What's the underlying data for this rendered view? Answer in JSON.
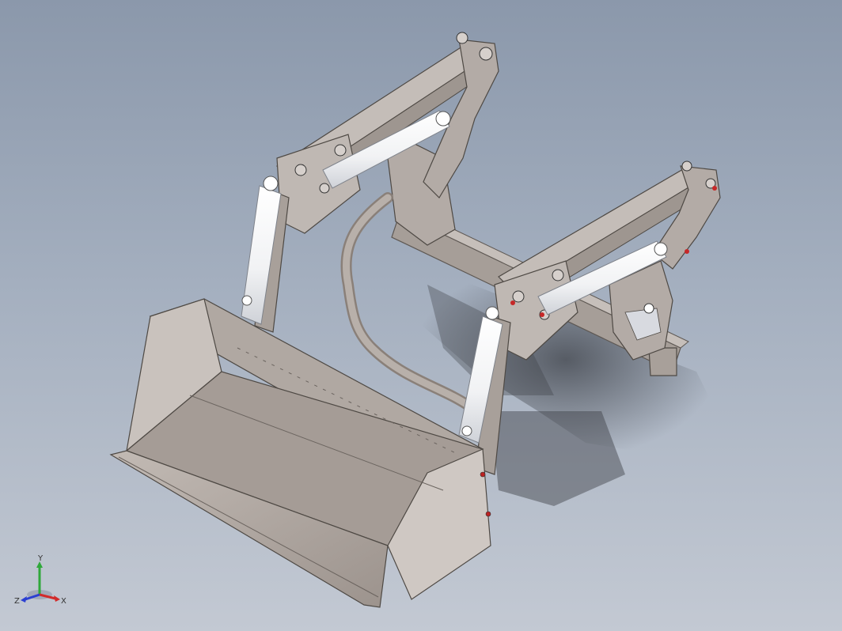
{
  "viewport": {
    "background_top": "#8b98ab",
    "background_bottom": "#c3c9d3"
  },
  "model": {
    "frame_color": "#b2aaa5",
    "frame_dark": "#6f6862",
    "cylinder_color": "#f4f5f7",
    "bucket_color": "#ada49e",
    "shadow_color": "#3b3e45"
  },
  "triad": {
    "x_label": "X",
    "y_label": "Y",
    "z_label": "Z",
    "x_color": "#d22b2b",
    "y_color": "#2fa83a",
    "z_color": "#2b3fd2"
  }
}
